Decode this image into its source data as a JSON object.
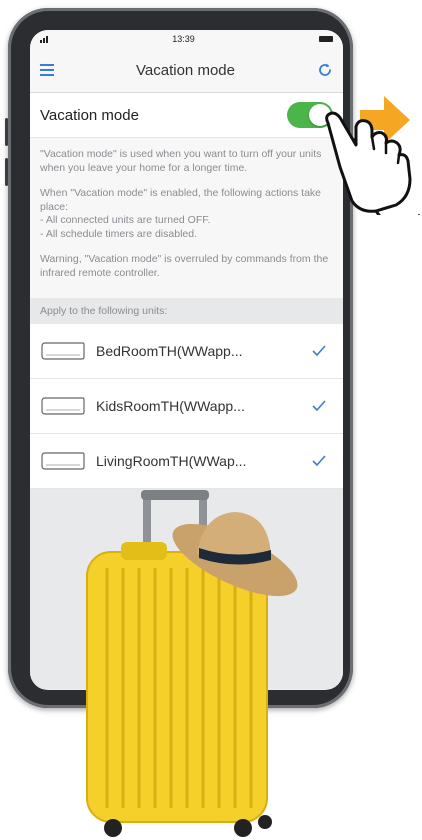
{
  "status_bar": {
    "time": "13:39"
  },
  "navbar": {
    "title": "Vacation mode",
    "menu_icon": "hamburger-menu-icon",
    "refresh_icon": "refresh-icon",
    "accent_color": "#3a7bd5"
  },
  "vacation_toggle": {
    "label": "Vacation mode",
    "state": "on",
    "on_color": "#4cb54a"
  },
  "description": {
    "paragraph_1": "\"Vacation mode\" is used when you want to turn off your units when you leave your home for a longer time.",
    "paragraph_2": "When \"Vacation mode\" is enabled, the following actions take place:\n- All connected units are turned OFF.\n- All schedule timers are disabled.",
    "paragraph_3": "Warning, \"Vacation mode\" is overruled by commands from the infrared remote controller."
  },
  "units_section": {
    "header": "Apply to the following units:",
    "units": [
      {
        "name": "BedRoomTH(WWapp...",
        "icon": "air-conditioner-icon",
        "checked": true
      },
      {
        "name": "KidsRoomTH(WWapp...",
        "icon": "air-conditioner-icon",
        "checked": true
      },
      {
        "name": "LivingRoomTH(WWap...",
        "icon": "air-conditioner-icon",
        "checked": true
      }
    ],
    "check_color": "#3a7bd5"
  },
  "illustration": {
    "pointer": "pointing-hand-icon",
    "arrow_color": "#f5a623",
    "suitcase_color": "#f5d02a",
    "hat": "straw-hat"
  }
}
